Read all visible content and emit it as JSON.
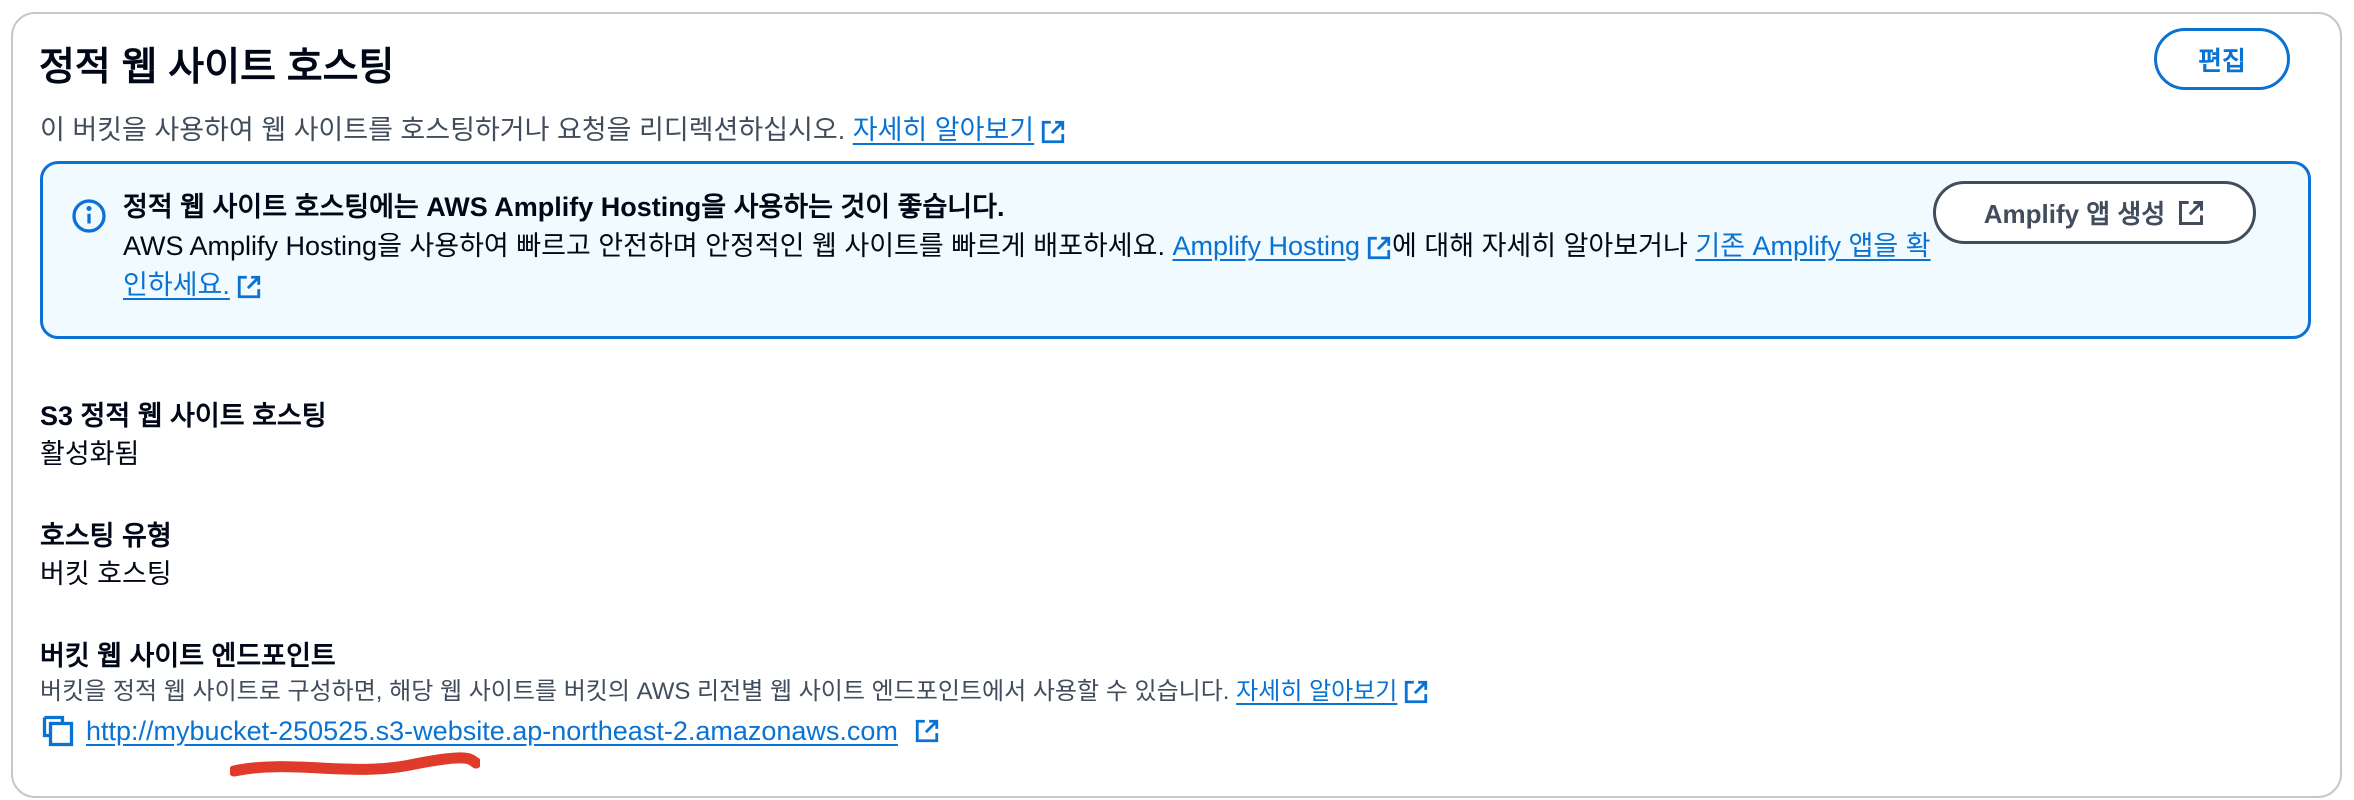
{
  "section": {
    "title": "정적 웹 사이트 호스팅",
    "edit_label": "편집",
    "description": "이 버킷을 사용하여 웹 사이트를 호스팅하거나 요청을 리디렉션하십시오.",
    "learn_more": "자세히 알아보기"
  },
  "alert": {
    "heading": "정적 웹 사이트 호스팅에는 AWS Amplify Hosting을 사용하는 것이 좋습니다.",
    "body_prefix": "AWS Amplify Hosting을 사용하여 빠르고 안전하며 안정적인 웹 사이트를 빠르게 배포하세요.",
    "link_hosting": "Amplify Hosting",
    "body_middle": "에 대해 자세히 알아보거나",
    "link_existing": "기존 Amplify 앱을 확인하세요.",
    "button_label": "Amplify 앱 생성"
  },
  "fields": {
    "hosting_label": "S3 정적 웹 사이트 호스팅",
    "hosting_value": "활성화됨",
    "type_label": "호스팅 유형",
    "type_value": "버킷 호스팅",
    "endpoint_label": "버킷 웹 사이트 엔드포인트",
    "endpoint_desc": "버킷을 정적 웹 사이트로 구성하면, 해당 웹 사이트를 버킷의 AWS 리전별 웹 사이트 엔드포인트에서 사용할 수 있습니다.",
    "endpoint_learn_more": "자세히 알아보기",
    "endpoint_url": "http://mybucket-250525.s3-website.ap-northeast-2.amazonaws.com"
  },
  "colors": {
    "link": "#0972d3",
    "alert_bg": "#f1faff",
    "redaction": "#e03a2a"
  }
}
